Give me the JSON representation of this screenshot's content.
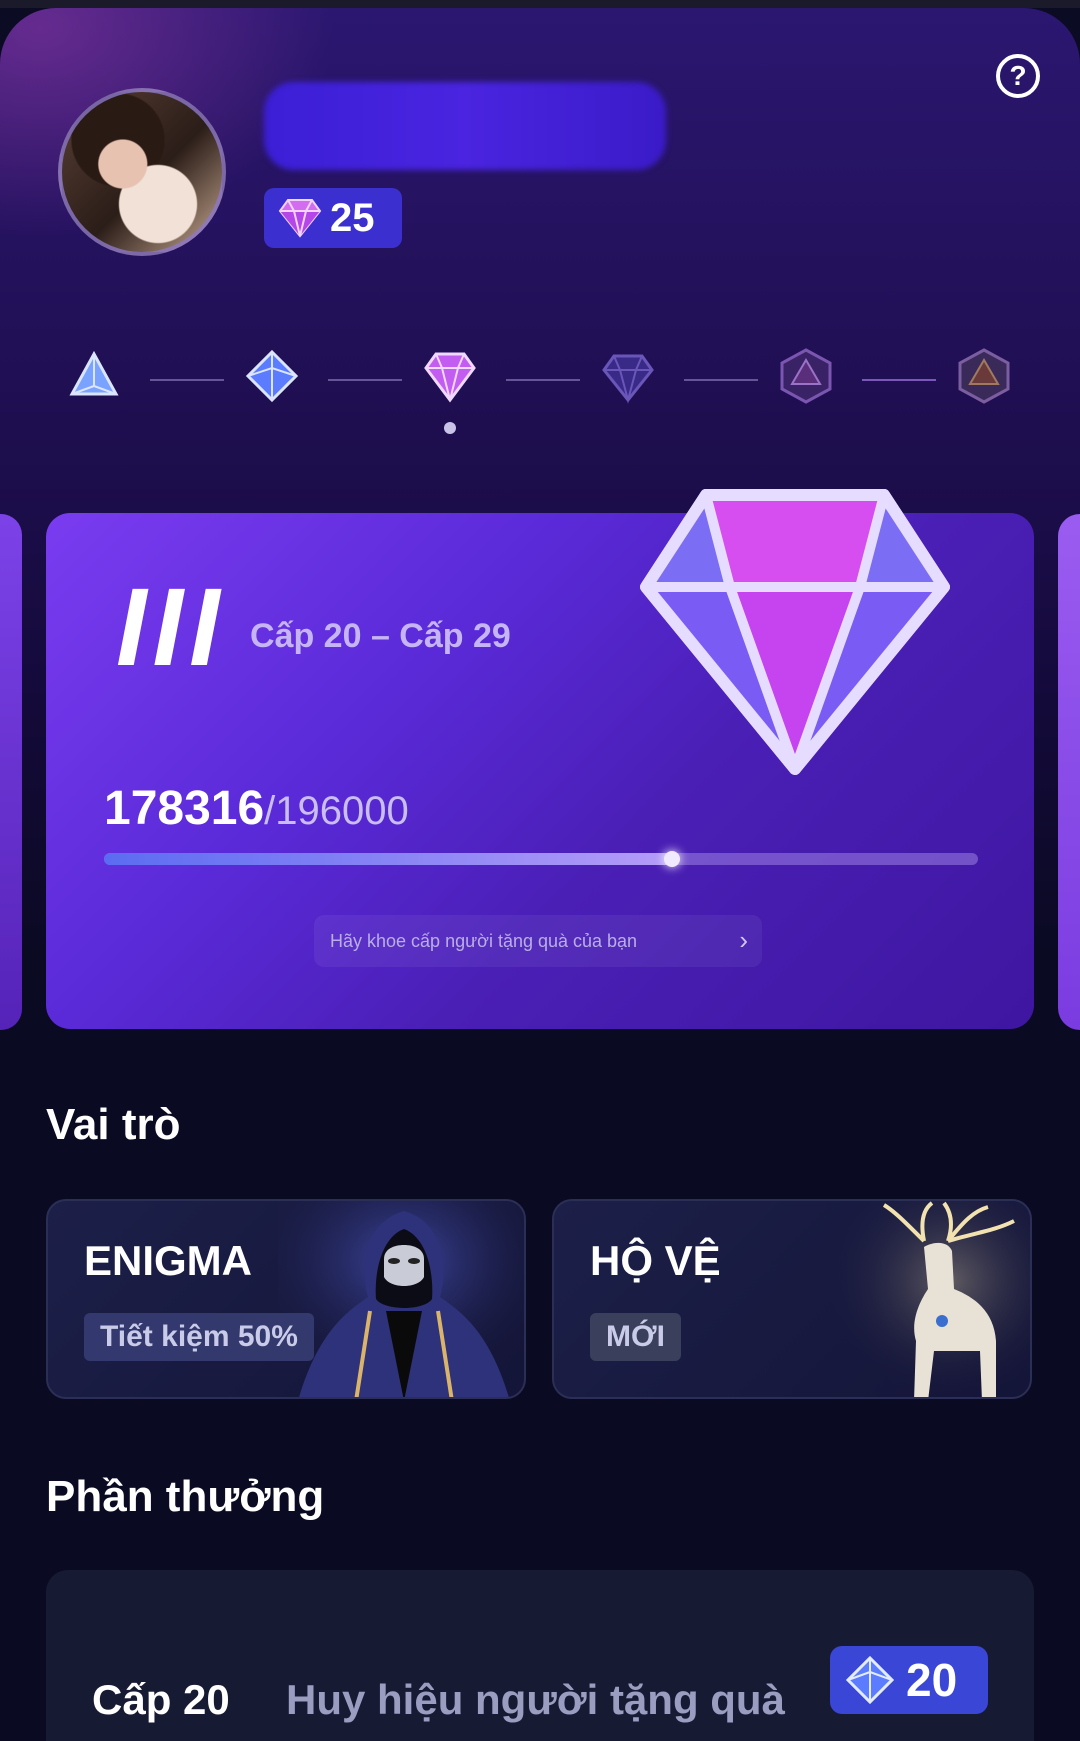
{
  "header": {
    "help_icon": "question-circle-icon",
    "diamond_count": "25"
  },
  "tiers": {
    "icons": [
      "triangle-gem-icon",
      "blue-diamond-icon",
      "purple-diamond-icon",
      "dark-diamond-icon",
      "hexagon-gem-icon",
      "hexagon-gem-icon"
    ],
    "current_index": 2
  },
  "level_card": {
    "roman": "III",
    "range": "Cấp 20 – Cấp 29",
    "current_points": "178316",
    "total_points": "/196000",
    "progress": 0.652,
    "share_text": "Hãy khoe cấp người tặng quà của bạn",
    "share_chevron": "›"
  },
  "roles": {
    "title": "Vai trò",
    "items": [
      {
        "title": "ENIGMA",
        "tag": "Tiết kiệm 50%"
      },
      {
        "title": "HỘ VỆ",
        "tag": "MỚI"
      }
    ]
  },
  "rewards": {
    "title": "Phần thưởng",
    "items": [
      {
        "level": "Cấp 20",
        "desc": "Huy hiệu người tặng quà",
        "badge": "20"
      }
    ]
  },
  "colors": {
    "accent": "#5a2ad8",
    "badge_blue": "#3a46d6",
    "background": "#0a0a22"
  }
}
